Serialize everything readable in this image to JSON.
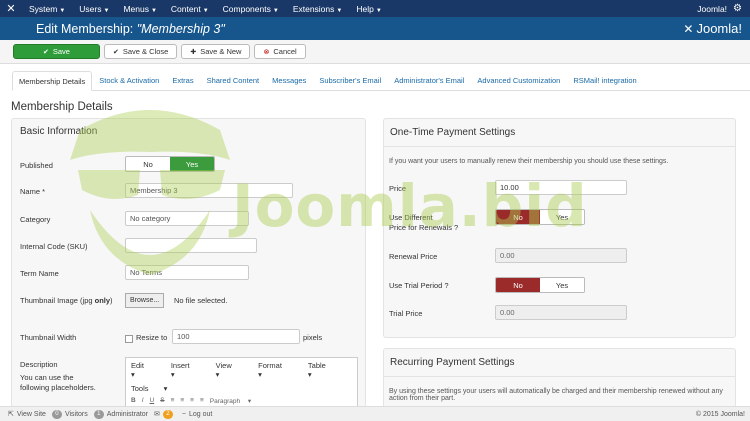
{
  "topbar": {
    "menu": [
      "System",
      "Users",
      "Menus",
      "Content",
      "Components",
      "Extensions",
      "Help"
    ],
    "site_name": "Joomla!"
  },
  "header": {
    "title_prefix": "Edit Membership: ",
    "title_name": "\"Membership 3\"",
    "brand": "Joomla!"
  },
  "toolbar": {
    "save": "Save",
    "save_close": "Save & Close",
    "save_new": "Save & New",
    "cancel": "Cancel"
  },
  "tabs": [
    "Membership Details",
    "Stock & Activation",
    "Extras",
    "Shared Content",
    "Messages",
    "Subscriber's Email",
    "Administrator's Email",
    "Advanced Customization",
    "RSMail! integration"
  ],
  "section_title": "Membership Details",
  "basic": {
    "title": "Basic Information",
    "published_label": "Published",
    "no": "No",
    "yes": "Yes",
    "name_label": "Name *",
    "name_value": "Membership 3",
    "category_label": "Category",
    "category_value": "No category",
    "sku_label": "Internal Code (SKU)",
    "sku_value": "",
    "term_label": "Term Name",
    "term_value": "No Terms",
    "thumb_label_a": "Thumbnail Image (jpg ",
    "thumb_label_b": "only",
    "thumb_label_c": ")",
    "browse": "Browse...",
    "no_file": "No file selected.",
    "thumb_width_label": "Thumbnail Width",
    "resize_to": "Resize to",
    "width_value": "100",
    "pixels": "pixels",
    "desc_label": "Description",
    "desc_help_1": "You can use the",
    "desc_help_2": "following placeholders.",
    "editor_menu": [
      "Edit",
      "Insert",
      "View",
      "Format",
      "Table"
    ],
    "editor_tools": "Tools",
    "editor_paragraph": "Paragraph"
  },
  "onetime": {
    "title": "One-Time Payment Settings",
    "desc": "If you want your users to manually renew their membership you should use these settings.",
    "price_label": "Price",
    "price_value": "10.00",
    "diff_label_1": "Use Different",
    "diff_label_2": "Price for Renewals ?",
    "no": "No",
    "yes": "Yes",
    "renewal_label": "Renewal Price",
    "renewal_value": "0.00",
    "trial_period_label": "Use Trial Period ?",
    "trial_price_label": "Trial Price",
    "trial_price_value": "0.00"
  },
  "recurring": {
    "title": "Recurring Payment Settings",
    "desc": "By using these settings your users will automatically be charged and their membership renewed without any action from their part."
  },
  "watermark": "Joomla.bid",
  "status": {
    "view_site": "View Site",
    "visitors_count": "0",
    "visitors": "Visitors",
    "admin_count": "1",
    "admin": "Administrator",
    "messages_count": "2",
    "logout": "Log out",
    "copyright": "© 2015 Joomla!"
  },
  "colors": {
    "topbar": "#1a3867",
    "header": "#17568c",
    "save_green": "#2f9c3a",
    "toggle_yes_green": "#3c9b3c",
    "toggle_no_red": "#9b2a2a",
    "link_blue": "#1a6aa8"
  }
}
